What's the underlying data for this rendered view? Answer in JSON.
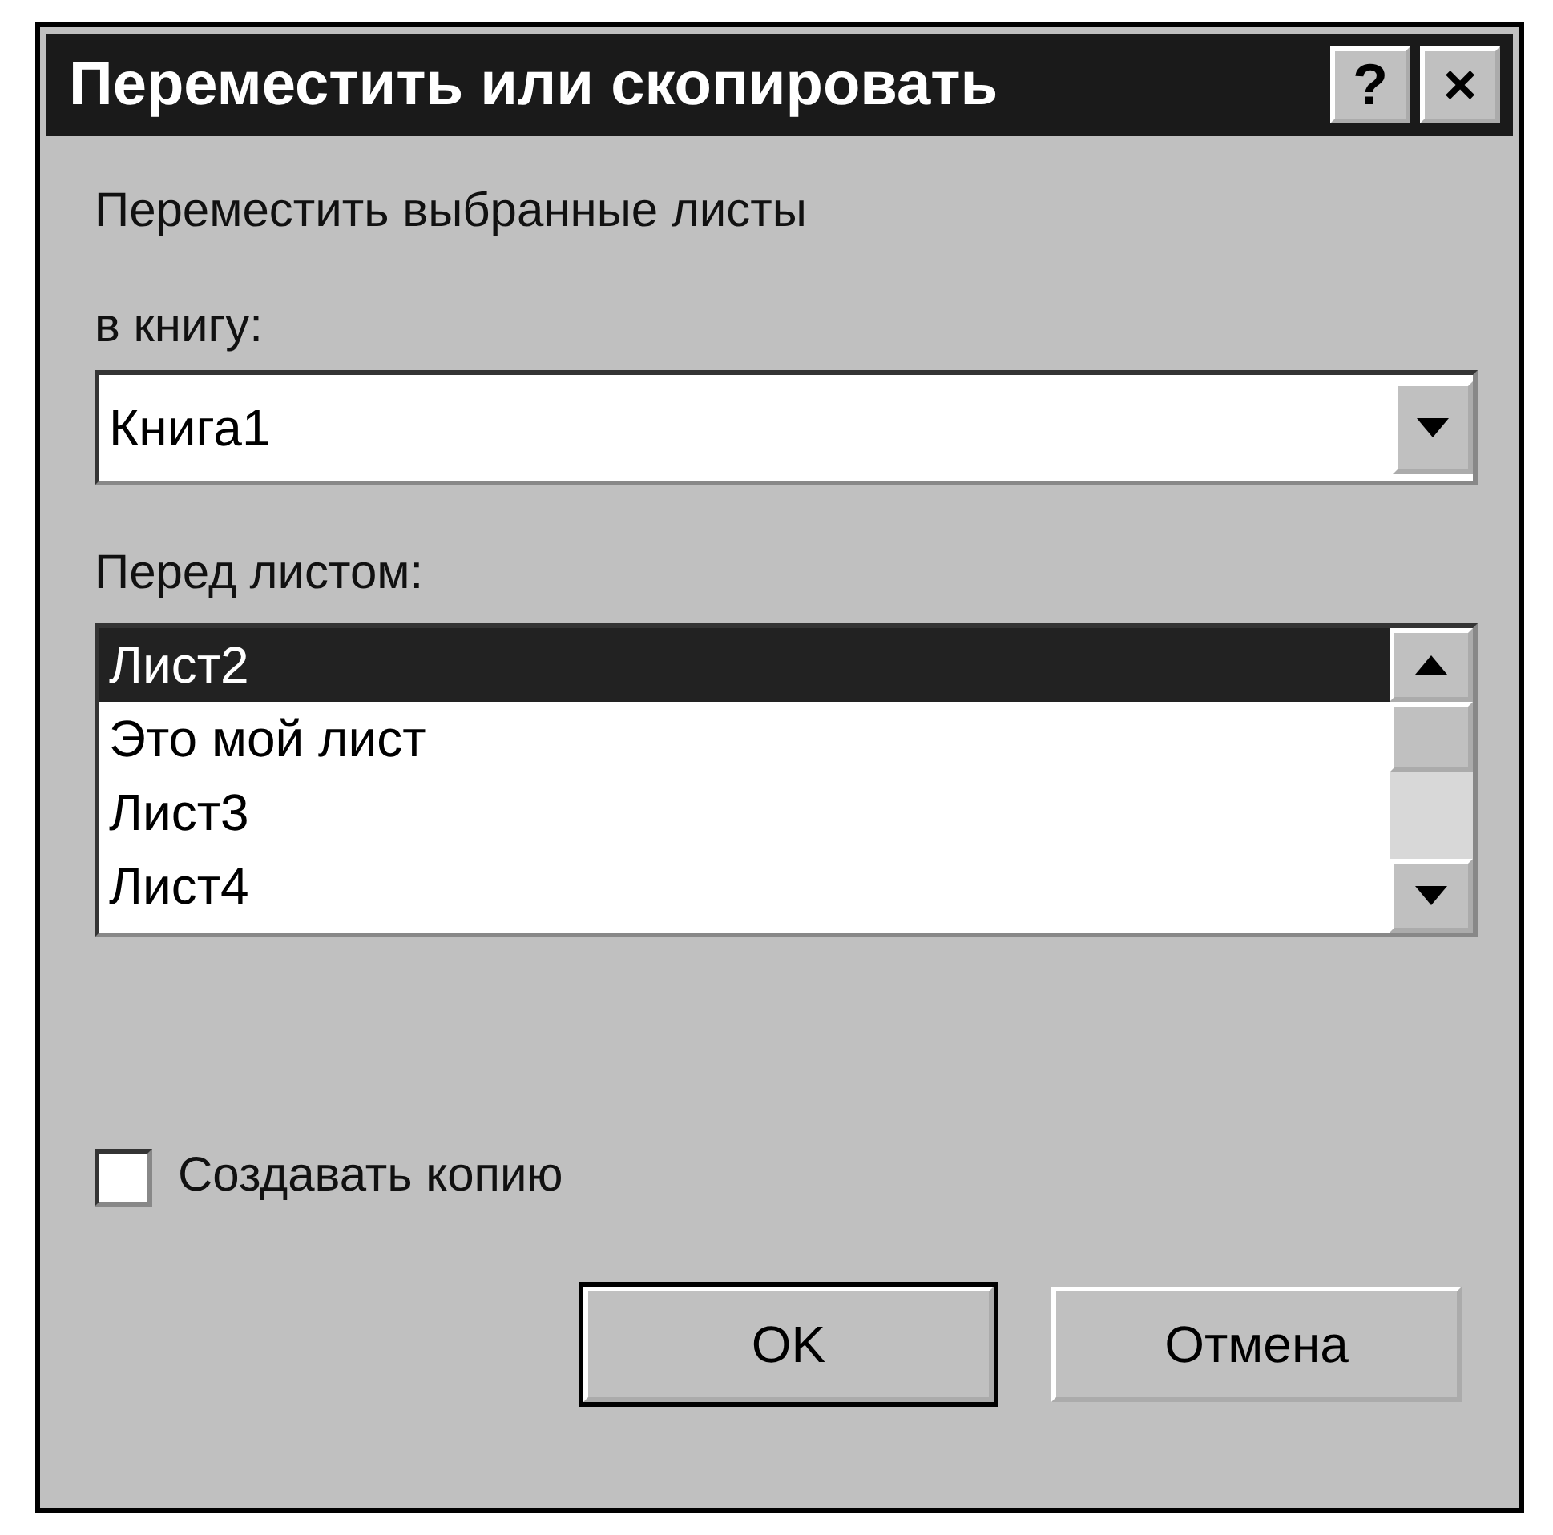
{
  "window": {
    "title": "Переместить или скопировать",
    "help_button": "?",
    "close_button": "×"
  },
  "prompt": "Переместить выбранные листы",
  "book": {
    "label": "в книгу:",
    "value": "Книга1"
  },
  "before_sheet": {
    "label": "Перед листом:",
    "items": [
      {
        "label": "Лист2",
        "selected": true
      },
      {
        "label": "Это мой лист",
        "selected": false
      },
      {
        "label": "Лист3",
        "selected": false
      },
      {
        "label": "Лист4",
        "selected": false
      }
    ]
  },
  "copy": {
    "label": "Создавать копию",
    "checked": false
  },
  "buttons": [
    "OK",
    "Отмена"
  ]
}
